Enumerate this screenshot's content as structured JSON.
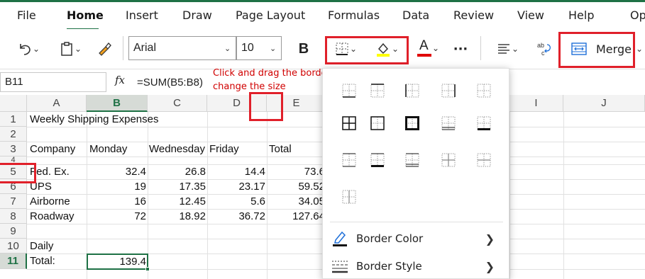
{
  "ribbon": {
    "tabs": [
      {
        "label": "File"
      },
      {
        "label": "Home"
      },
      {
        "label": "Insert"
      },
      {
        "label": "Draw"
      },
      {
        "label": "Page Layout"
      },
      {
        "label": "Formulas"
      },
      {
        "label": "Data"
      },
      {
        "label": "Review"
      },
      {
        "label": "View"
      },
      {
        "label": "Help"
      },
      {
        "label": "Op"
      }
    ],
    "active_tab": "Home"
  },
  "toolbar": {
    "font_name": "Arial",
    "font_size": "10",
    "bold_label": "B",
    "font_color_label": "A",
    "merge_label": "Merge",
    "more_label": "···",
    "accent_color": "#1e7145",
    "fill_color": "#ffff00",
    "font_color": "#e00000",
    "icons": [
      "undo-icon",
      "clipboard-icon",
      "format-painter-icon",
      "borders-icon",
      "fill-color-icon",
      "font-color-icon",
      "more-icon",
      "align-icon",
      "wrap-text-icon",
      "merge-icon"
    ]
  },
  "formula_bar": {
    "name_box": "B11",
    "fx_label": "fx",
    "formula": "=SUM(B5:B8)"
  },
  "annotation": {
    "note": "Click and drag the border to change the size",
    "color": "#d00000"
  },
  "sheet": {
    "columns": [
      "A",
      "B",
      "C",
      "D",
      "E",
      "I",
      "J"
    ],
    "rows": [
      "1",
      "2",
      "3",
      "4",
      "5",
      "6",
      "7",
      "8",
      "9",
      "10",
      "11"
    ],
    "selected_column": "B",
    "selected_row": "11",
    "cells": {
      "A1": "Weekly Shipping Expenses",
      "A3": "Company",
      "B3": "Monday",
      "C3": "Wednesday",
      "D3": "Friday",
      "E3": "Total",
      "A5": "Fed. Ex.",
      "B5": "32.4",
      "C5": "26.8",
      "D5": "14.4",
      "E5": "73.6",
      "A6": "UPS",
      "B6": "19",
      "C6": "17.35",
      "D6": "23.17",
      "E6": "59.52",
      "A7": "Airborne",
      "B7": "16",
      "C7": "12.45",
      "D7": "5.6",
      "E7": "34.05",
      "A8": "Roadway",
      "B8": "72",
      "C8": "18.92",
      "D8": "36.72",
      "E8": "127.64",
      "A10": "Daily",
      "A11": "Total:",
      "B11": "139.4"
    }
  },
  "borders_menu": {
    "border_icons": [
      "border-bottom-icon",
      "border-top-icon",
      "border-left-icon",
      "border-right-icon",
      "no-border-icon",
      "all-borders-icon",
      "outside-borders-icon",
      "thick-box-border-icon",
      "bottom-double-border-icon",
      "thick-bottom-border-icon",
      "top-bottom-border-icon",
      "top-thick-bottom-border-icon",
      "top-double-bottom-border-icon",
      "inside-borders-icon",
      "inside-horizontal-border-icon",
      "inside-vertical-border-icon"
    ],
    "items": [
      {
        "label": "Border Color"
      },
      {
        "label": "Border Style"
      }
    ]
  }
}
